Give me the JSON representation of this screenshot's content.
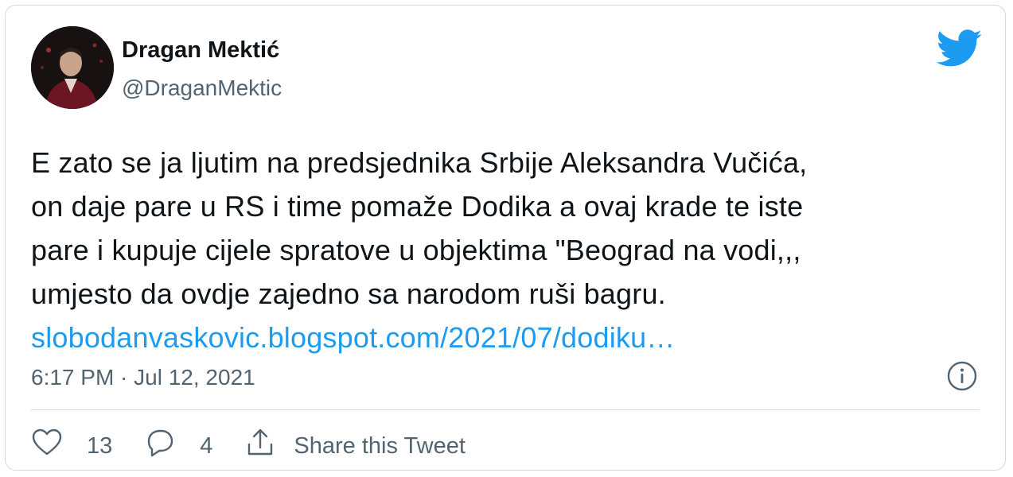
{
  "author": {
    "name": "Dragan Mektić",
    "handle": "@DraganMektic"
  },
  "tweet": {
    "lines": [
      "E zato se ja ljutim na predsjednika Srbije Aleksandra Vučića,",
      "on daje pare u RS i time pomaže Dodika a ovaj krade te iste",
      "pare i kupuje cijele spratove u objektima \"Beograd na vodi,,,",
      "umjesto da ovdje zajedno sa narodom ruši bagru."
    ],
    "link": "slobodanvaskovic.blogspot.com/2021/07/dodiku…",
    "timestamp": "6:17 PM · Jul 12, 2021"
  },
  "actions": {
    "likes": "13",
    "replies": "4",
    "share_label": "Share this Tweet"
  },
  "icons": {
    "brand": "twitter-bird-icon",
    "info": "info-icon",
    "like": "heart-icon",
    "reply": "reply-icon",
    "share": "share-icon"
  },
  "colors": {
    "brand": "#1d9bf0",
    "link": "#1d9bf0",
    "text": "#0f1419",
    "muted": "#536471",
    "border": "#cfd9de"
  }
}
